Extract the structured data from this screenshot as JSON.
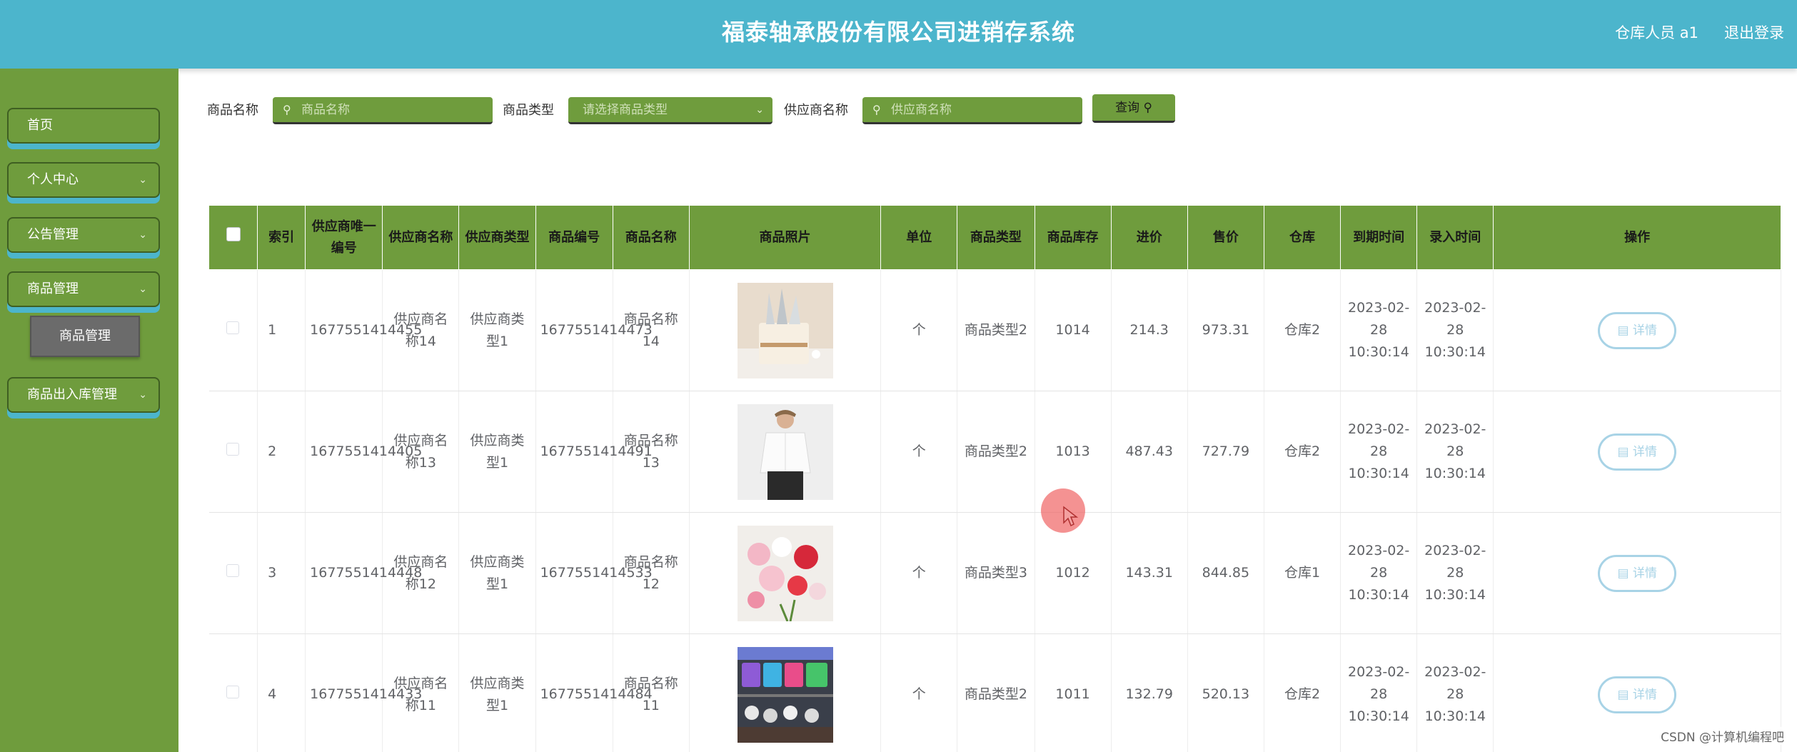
{
  "header": {
    "title": "福泰轴承股份有限公司进销存系统",
    "user": "仓库人员 a1",
    "logout": "退出登录"
  },
  "sidebar": {
    "items": [
      {
        "label": "首页"
      },
      {
        "label": "个人中心"
      },
      {
        "label": "公告管理"
      },
      {
        "label": "商品管理"
      },
      {
        "label": "商品出入库管理"
      }
    ],
    "submenu_label": "商品管理"
  },
  "search": {
    "name_label": "商品名称",
    "name_placeholder": "商品名称",
    "type_label": "商品类型",
    "type_placeholder": "请选择商品类型",
    "supplier_label": "供应商名称",
    "supplier_placeholder": "供应商名称",
    "query_button": "查询"
  },
  "table": {
    "headers": [
      "索引",
      "供应商唯一编号",
      "供应商名称",
      "供应商类型",
      "商品编号",
      "商品名称",
      "商品照片",
      "单位",
      "商品类型",
      "商品库存",
      "进价",
      "售价",
      "仓库",
      "到期时间",
      "录入时间",
      "操作"
    ],
    "rows": [
      {
        "index": "1",
        "supplier_id": "1677551414455",
        "supplier_name": "供应商名称14",
        "supplier_type": "供应商类型1",
        "product_no": "1677551414473",
        "product_name": "商品名称14",
        "photo": "knives-photo",
        "unit": "个",
        "product_type": "商品类型2",
        "stock": "1014",
        "cost": "214.3",
        "price": "973.31",
        "warehouse": "仓库2",
        "expire": "2023-02-28 10:30:14",
        "entry": "2023-02-28 10:30:14",
        "action": "详情"
      },
      {
        "index": "2",
        "supplier_id": "1677551414405",
        "supplier_name": "供应商名称13",
        "supplier_type": "供应商类型1",
        "product_no": "1677551414491",
        "product_name": "商品名称13",
        "photo": "shirt-photo",
        "unit": "个",
        "product_type": "商品类型2",
        "stock": "1013",
        "cost": "487.43",
        "price": "727.79",
        "warehouse": "仓库2",
        "expire": "2023-02-28 10:30:14",
        "entry": "2023-02-28 10:30:14",
        "action": "详情"
      },
      {
        "index": "3",
        "supplier_id": "1677551414448",
        "supplier_name": "供应商名称12",
        "supplier_type": "供应商类型1",
        "product_no": "1677551414533",
        "product_name": "商品名称12",
        "photo": "flowers-photo",
        "unit": "个",
        "product_type": "商品类型3",
        "stock": "1012",
        "cost": "143.31",
        "price": "844.85",
        "warehouse": "仓库1",
        "expire": "2023-02-28 10:30:14",
        "entry": "2023-02-28 10:30:14",
        "action": "详情"
      },
      {
        "index": "4",
        "supplier_id": "1677551414433",
        "supplier_name": "供应商名称11",
        "supplier_type": "供应商类型1",
        "product_no": "1677551414484",
        "product_name": "商品名称11",
        "photo": "buckets-photo",
        "unit": "个",
        "product_type": "商品类型2",
        "stock": "1011",
        "cost": "132.79",
        "price": "520.13",
        "warehouse": "仓库2",
        "expire": "2023-02-28 10:30:14",
        "entry": "2023-02-28 10:30:14",
        "action": "详情"
      }
    ]
  },
  "watermark": "CSDN @计算机编程吧",
  "colors": {
    "header": "#4cb5cc",
    "sidebar": "#6f9c3d",
    "accent": "#a8d3e6"
  }
}
